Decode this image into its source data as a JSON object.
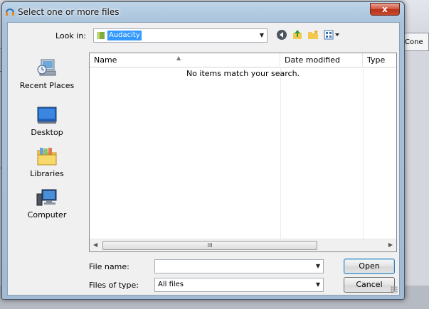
{
  "background_app": {
    "right_panel_label": "Cone"
  },
  "dialog": {
    "title": "Select one or more files",
    "close_label": "x",
    "look_in": {
      "label": "Look in:",
      "value": "Audacity"
    },
    "toolbar_icons": [
      "back-icon",
      "up-folder-icon",
      "new-folder-icon",
      "view-menu-icon"
    ],
    "places": [
      {
        "label": "Recent Places",
        "icon": "recent-places-icon"
      },
      {
        "label": "Desktop",
        "icon": "desktop-icon"
      },
      {
        "label": "Libraries",
        "icon": "libraries-icon"
      },
      {
        "label": "Computer",
        "icon": "computer-icon"
      }
    ],
    "list": {
      "columns": [
        "Name",
        "Date modified",
        "Type"
      ],
      "empty_message": "No items match your search.",
      "scroll_thumb_glyph": "III"
    },
    "file_name": {
      "label": "File name:",
      "value": ""
    },
    "file_type": {
      "label": "Files of type:",
      "value": "All files"
    },
    "buttons": {
      "open": "Open",
      "cancel": "Cancel"
    }
  }
}
